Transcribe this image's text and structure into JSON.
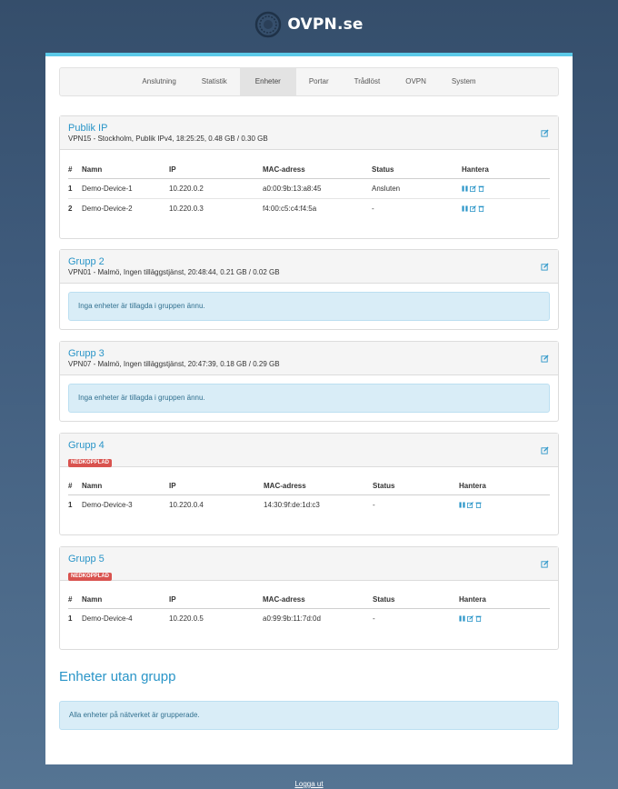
{
  "brand": {
    "name": "OVPN.se"
  },
  "nav": {
    "tabs": [
      {
        "label": "Anslutning"
      },
      {
        "label": "Statistik"
      },
      {
        "label": "Enheter",
        "active": true
      },
      {
        "label": "Portar"
      },
      {
        "label": "Trådlöst"
      },
      {
        "label": "OVPN"
      },
      {
        "label": "System"
      }
    ]
  },
  "table_headers": {
    "num": "#",
    "name": "Namn",
    "ip": "IP",
    "mac": "MAC-adress",
    "status": "Status",
    "manage": "Hantera"
  },
  "groups": [
    {
      "title": "Publik IP",
      "subtitle": "VPN15 - Stockholm, Publik IPv4, 18:25:25, 0.48 GB / 0.30 GB",
      "devices": [
        {
          "num": "1",
          "name": "Demo-Device-1",
          "ip": "10.220.0.2",
          "mac": "a0:00:9b:13:a8:45",
          "status": "Ansluten"
        },
        {
          "num": "2",
          "name": "Demo-Device-2",
          "ip": "10.220.0.3",
          "mac": "f4:00:c5:c4:f4:5a",
          "status": "-"
        }
      ]
    },
    {
      "title": "Grupp 2",
      "subtitle": "VPN01 - Malmö, Ingen tilläggstjänst, 20:48:44, 0.21 GB / 0.02 GB",
      "empty_message": "Inga enheter är tillagda i gruppen ännu."
    },
    {
      "title": "Grupp 3",
      "subtitle": "VPN07 - Malmö, Ingen tilläggstjänst, 20:47:39, 0.18 GB / 0.29 GB",
      "empty_message": "Inga enheter är tillagda i gruppen ännu."
    },
    {
      "title": "Grupp 4",
      "badge": "NEDKOPPLAD",
      "devices": [
        {
          "num": "1",
          "name": "Demo-Device-3",
          "ip": "10.220.0.4",
          "mac": "14:30:9f:de:1d:c3",
          "status": "-"
        }
      ]
    },
    {
      "title": "Grupp 5",
      "badge": "NEDKOPPLAD",
      "devices": [
        {
          "num": "1",
          "name": "Demo-Device-4",
          "ip": "10.220.0.5",
          "mac": "a0:99:9b:11:7d:0d",
          "status": "-"
        }
      ]
    }
  ],
  "ungrouped": {
    "title": "Enheter utan grupp",
    "message": "Alla enheter på nätverket är grupperade."
  },
  "footer": {
    "logout": "Logga ut"
  },
  "colors": {
    "accent": "#2a95c8",
    "top_bar": "#5bc9e8",
    "badge": "#d9534f",
    "alert_bg": "#d9edf7"
  }
}
